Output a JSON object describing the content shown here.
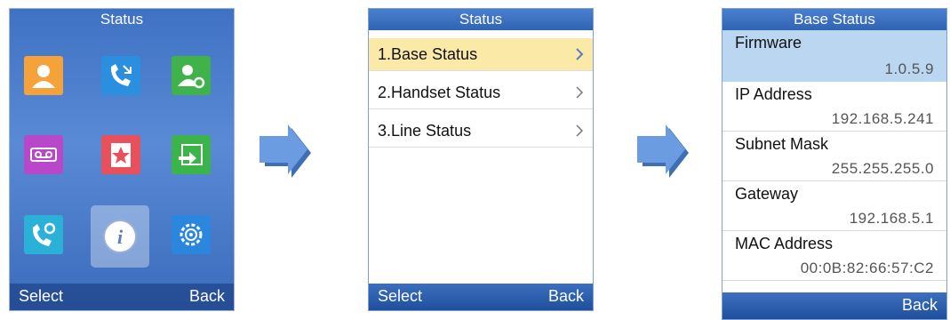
{
  "screen1": {
    "title": "Status",
    "softkey_left": "Select",
    "softkey_right": "Back",
    "apps": [
      {
        "icon": "contacts-icon",
        "color": "#f5a23a"
      },
      {
        "icon": "call-history-icon",
        "color": "#2b8fe0"
      },
      {
        "icon": "contact-settings-icon",
        "color": "#3fb24a"
      },
      {
        "icon": "voicemail-icon",
        "color": "#b848c9"
      },
      {
        "icon": "favorites-icon",
        "color": "#e8505b"
      },
      {
        "icon": "transfer-icon",
        "color": "#3bb54a"
      },
      {
        "icon": "call-settings-icon",
        "color": "#2bb0d8"
      },
      {
        "icon": "status-info-icon",
        "color": "#c9d6ee"
      },
      {
        "icon": "settings-icon",
        "color": "#2b86de"
      }
    ]
  },
  "screen2": {
    "title": "Status",
    "items": [
      "1.Base Status",
      "2.Handset Status",
      "3.Line Status"
    ],
    "softkey_left": "Select",
    "softkey_right": "Back"
  },
  "screen3": {
    "title": "Base Status",
    "fields": [
      {
        "label": "Firmware",
        "value": "1.0.5.9"
      },
      {
        "label": "IP Address",
        "value": "192.168.5.241"
      },
      {
        "label": "Subnet Mask",
        "value": "255.255.255.0"
      },
      {
        "label": "Gateway",
        "value": "192.168.5.1"
      },
      {
        "label": "MAC Address",
        "value": "00:0B:82:66:57:C2"
      }
    ],
    "softkey_right": "Back"
  },
  "colors": {
    "accent": "#2f64b3",
    "selected_item": "#fbe9a8",
    "selected_field": "#bad6f1",
    "arrow": "#5b8fd6"
  }
}
